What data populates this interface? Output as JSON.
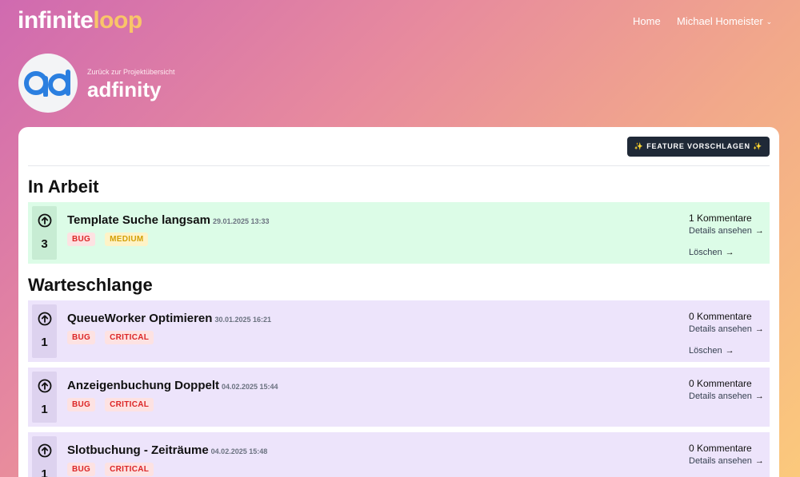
{
  "app": {
    "logo_part1": "infinite",
    "logo_part2": "loop"
  },
  "nav": {
    "home": "Home",
    "user": "Michael Homeister"
  },
  "project": {
    "back_link": "Zurück zur Projektübersicht",
    "title": "adfinity"
  },
  "toolbar": {
    "feature_button": "✨ FEATURE VORSCHLAGEN ✨"
  },
  "sections": {
    "in_progress": "In Arbeit",
    "queue": "Warteschlange"
  },
  "items": [
    {
      "votes": "3",
      "title": "Template Suche langsam",
      "date": "29.01.2025 13:33",
      "tags": [
        "BUG",
        "MEDIUM"
      ],
      "comments": "1 Kommentare",
      "details": "Details ansehen",
      "delete": "Löschen"
    },
    {
      "votes": "1",
      "title": "QueueWorker Optimieren",
      "date": "30.01.2025 16:21",
      "tags": [
        "BUG",
        "CRITICAL"
      ],
      "comments": "0 Kommentare",
      "details": "Details ansehen",
      "delete": "Löschen"
    },
    {
      "votes": "1",
      "title": "Anzeigenbuchung Doppelt",
      "date": "04.02.2025 15:44",
      "tags": [
        "BUG",
        "CRITICAL"
      ],
      "comments": "0 Kommentare",
      "details": "Details ansehen"
    },
    {
      "votes": "1",
      "title": "Slotbuchung - Zeiträume",
      "date": "04.02.2025 15:48",
      "tags": [
        "BUG",
        "CRITICAL"
      ],
      "comments": "0 Kommentare",
      "details": "Details ansehen"
    }
  ],
  "icons": {
    "vote": "arrow-up-circle-icon",
    "link_arrow": "arrow-right-icon",
    "chevron": "chevron-down-icon"
  },
  "colors": {
    "in_progress_bg": "#dcfce7",
    "queue_bg": "#ede4fb",
    "accent_logo": "#f9c569",
    "button_dark": "#1f2937",
    "bug_red": "#dc2626",
    "medium_yellow": "#d4a006"
  }
}
